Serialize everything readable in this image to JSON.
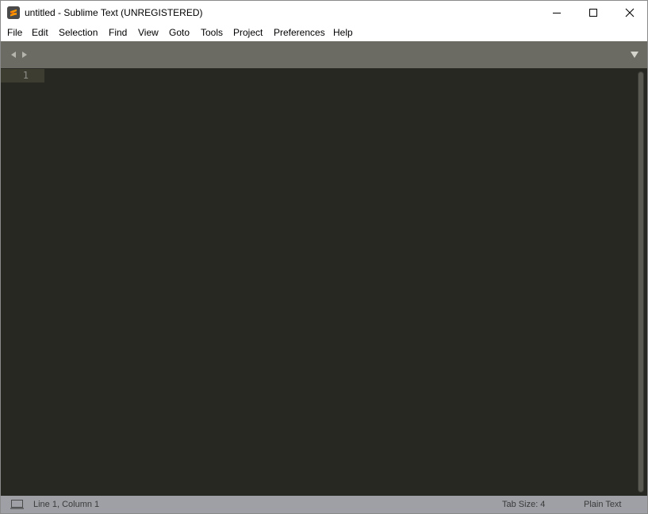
{
  "window": {
    "title": "untitled - Sublime Text (UNREGISTERED)",
    "app_icon": "sublime-text-logo-icon",
    "controls": [
      "minimize-icon",
      "maximize-icon",
      "close-icon"
    ]
  },
  "menu": {
    "items": [
      "File",
      "Edit",
      "Selection",
      "Find",
      "View",
      "Goto",
      "Tools",
      "Project",
      "Preferences",
      "Help"
    ]
  },
  "tabbar": {
    "icons": [
      "arrow-left-icon",
      "arrow-right-icon",
      "dropdown-triangle-icon"
    ]
  },
  "editor": {
    "line_numbers": [
      "1"
    ],
    "content": "",
    "background_color": "#272822",
    "current_line_color": "#3e3d32"
  },
  "statusbar": {
    "panel_icon": "panel-toggle-icon",
    "position": "Line 1, Column 1",
    "tab_size": "Tab Size: 4",
    "syntax": "Plain Text"
  }
}
